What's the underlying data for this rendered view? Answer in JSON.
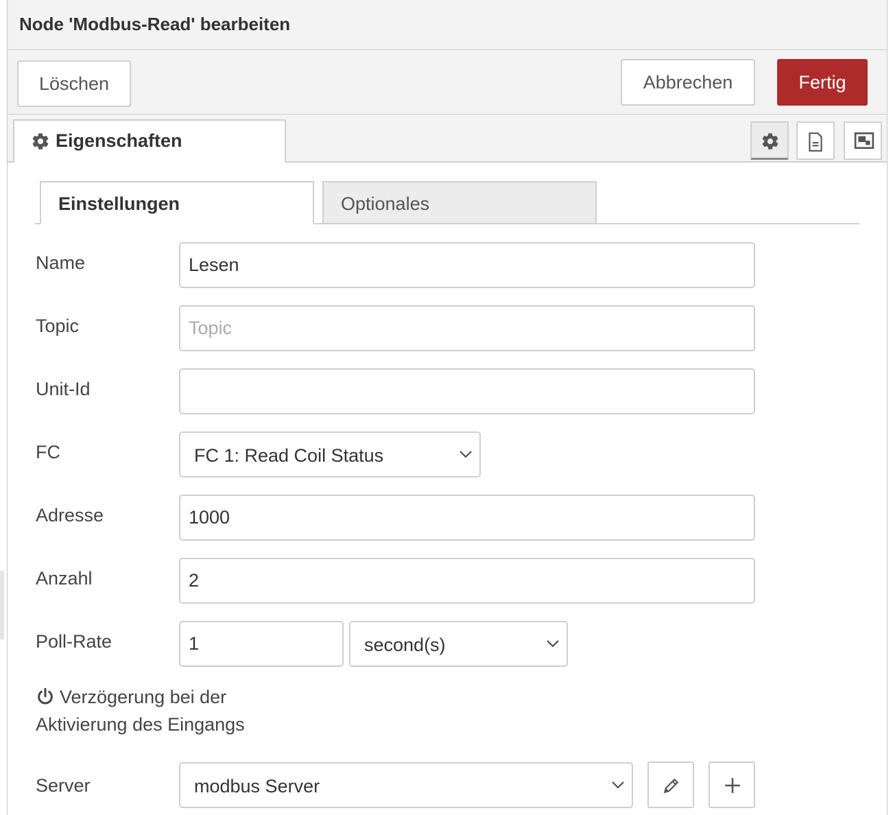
{
  "header": {
    "title": "Node 'Modbus-Read' bearbeiten"
  },
  "toolbar": {
    "delete_label": "Löschen",
    "cancel_label": "Abbrechen",
    "done_label": "Fertig",
    "done_color": "#ad2b2a"
  },
  "properties_tab": {
    "label": "Eigenschaften",
    "icon": "gear-icon",
    "side_icons": [
      "gear-icon",
      "description-icon",
      "appearance-icon"
    ]
  },
  "subtabs": [
    {
      "label": "Einstellungen",
      "active": true
    },
    {
      "label": "Optionales",
      "active": false
    }
  ],
  "form": {
    "name": {
      "label": "Name",
      "value": "Lesen",
      "placeholder": ""
    },
    "topic": {
      "label": "Topic",
      "value": "",
      "placeholder": "Topic"
    },
    "unit_id": {
      "label": "Unit-Id",
      "value": ""
    },
    "fc": {
      "label": "FC",
      "selected": "FC 1: Read Coil Status"
    },
    "address": {
      "label": "Adresse",
      "value": "1000"
    },
    "quantity": {
      "label": "Anzahl",
      "value": "2"
    },
    "poll_rate": {
      "label": "Poll-Rate",
      "value": "1",
      "unit": "second(s)"
    },
    "delay": {
      "label_line1": "Verzögerung bei der",
      "label_line2": "Aktivierung des Eingangs",
      "icon": "power-icon",
      "checked": false
    },
    "server": {
      "label": "Server",
      "selected": "modbus Server",
      "edit_icon": "pencil-icon",
      "add_icon": "plus-icon"
    }
  }
}
